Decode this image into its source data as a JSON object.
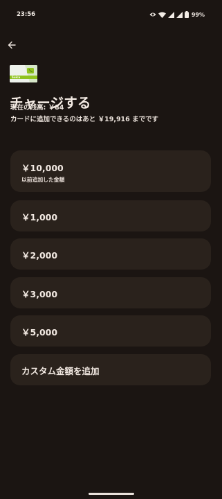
{
  "status_bar": {
    "time": "23:56",
    "battery_text": "99%",
    "icons": [
      "eye-icon",
      "wifi-icon",
      "signal-icon",
      "signal-icon",
      "battery-icon"
    ]
  },
  "header": {
    "back_icon": "arrow-left-icon",
    "card_logo_text": "Suica",
    "title": "チャージする"
  },
  "balance": {
    "current": "現在の残高: ￥84",
    "limit": "カードに追加できるのはあと ￥19,916 までです"
  },
  "options": [
    {
      "amount": "￥10,000",
      "sub": "以前追加した金額"
    },
    {
      "amount": "￥1,000"
    },
    {
      "amount": "￥2,000"
    },
    {
      "amount": "￥3,000"
    },
    {
      "amount": "￥5,000"
    },
    {
      "amount": "カスタム金額を追加"
    }
  ],
  "colors": {
    "background": "#1b1512",
    "option_surface": "#2a221c",
    "text": "#efe6df",
    "card_green": "#8fc31f"
  }
}
